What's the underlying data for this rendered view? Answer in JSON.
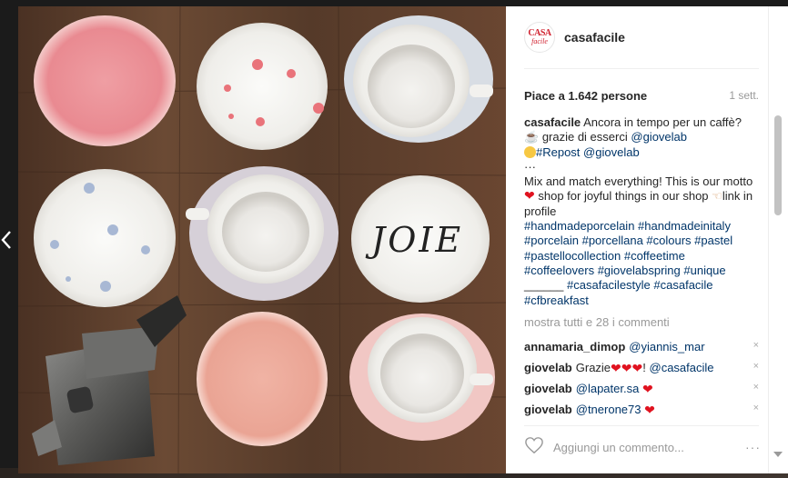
{
  "post": {
    "username": "casafacile",
    "avatar_text_top": "CASA",
    "avatar_text_bottom": "facile",
    "likes": "Piace a 1.642 persone",
    "age": "1 sett.",
    "caption": {
      "username": "casafacile",
      "line1": "Ancora in tempo per un caffè?",
      "line2": "grazie di esserci",
      "mention1": "@giovelab",
      "repost_tag": "#Repost",
      "mention2": "@giovelab",
      "ellipsis": "···",
      "text1": "Mix and match everything! This is our motto",
      "text2": "shop for joyful things in our shop",
      "text3": "link in profile",
      "hashtags_line1": "#handmadeporcelain #handmadeinitaly",
      "hashtags_line2": "#porcelain #porcellana #colours #pastel",
      "hashtags_line3": "#pastellocollection #coffeetime",
      "hashtags_line4": "#coffeelovers #giovelabspring #unique",
      "underline_prefix": "______",
      "hashtags_line5": "#casafacilestyle #casafacile",
      "hashtags_line6": "#cfbreakfast"
    },
    "more_comments": "mostra tutti e 28 i commenti",
    "comments": [
      {
        "user": "annamaria_dimop",
        "mention": "@yiannis_mar",
        "pre": "",
        "hearts": "",
        "post": ""
      },
      {
        "user": "giovelab",
        "mention": "@casafacile",
        "pre": "Grazie",
        "hearts": "❤❤❤",
        "post": "!"
      },
      {
        "user": "giovelab",
        "mention": "@lapater.sa",
        "pre": "",
        "hearts": "❤",
        "post": ""
      },
      {
        "user": "giovelab",
        "mention": "@tnerone73",
        "pre": "",
        "hearts": "❤",
        "post": ""
      }
    ],
    "comment_placeholder": "Aggiungi un commento...",
    "more_options": "···",
    "delete_symbol": "×",
    "photo_text": "JOIE"
  },
  "colors": {
    "link": "#003569",
    "heart": "#e0121f",
    "brand_red": "#d0202e",
    "wood": "#5a3e2c"
  },
  "icons": [
    "chevron-left-icon",
    "heart-outline-icon",
    "more-options-icon",
    "close-icon",
    "coffee-cup-icon",
    "smile-icon",
    "pointing-hand-icon",
    "red-heart-icon"
  ]
}
